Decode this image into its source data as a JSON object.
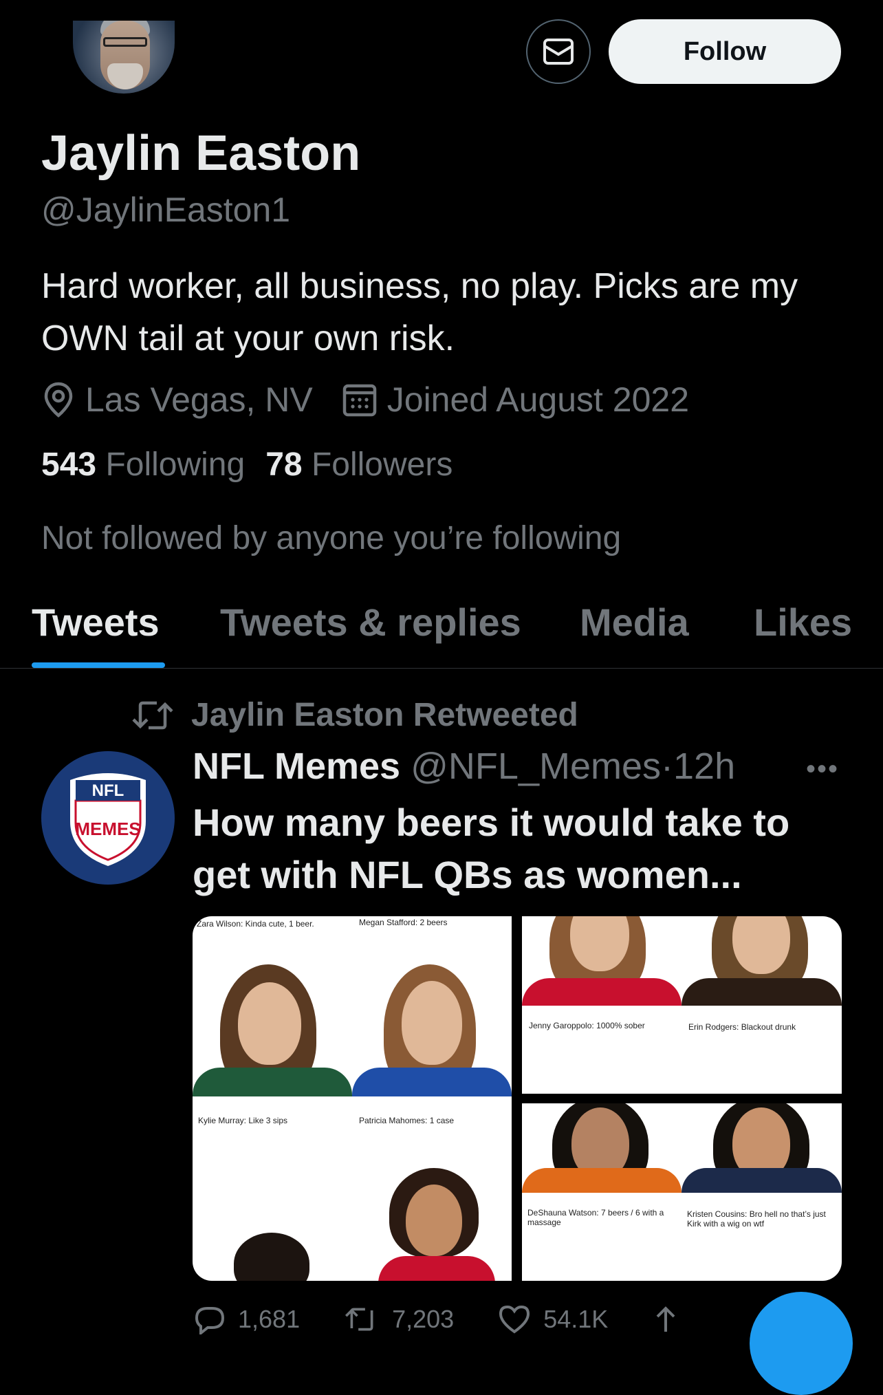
{
  "header": {
    "follow_label": "Follow",
    "message_icon": "envelope-icon"
  },
  "profile": {
    "name": "Jaylin Easton",
    "handle": "@JaylinEaston1",
    "bio": "Hard worker, all business, no play. Picks are my OWN tail at your own risk.",
    "location": "Las Vegas, NV",
    "joined": "Joined August 2022",
    "following_count": "543",
    "following_label": "Following",
    "followers_count": "78",
    "followers_label": "Followers",
    "not_followed": "Not followed by anyone you’re following"
  },
  "tabs": [
    {
      "label": "Tweets",
      "active": true
    },
    {
      "label": "Tweets & replies",
      "active": false
    },
    {
      "label": "Media",
      "active": false
    },
    {
      "label": "Likes",
      "active": false
    }
  ],
  "tweet": {
    "retweeted_by": "Jaylin Easton Retweeted",
    "display_name": "NFL Memes",
    "username": "@NFL_Memes",
    "separator": "·",
    "time": "12h",
    "text": "How many beers it would take to get with NFL QBs as women...",
    "avatar_top": "NFL",
    "avatar_main": "MEMES",
    "media_captions": {
      "tl_1": "Zara Wilson: Kinda cute, 1 beer.",
      "tl_2": "Megan Stafford: 2 beers",
      "tl_3": "Kylie Murray: Like 3 sips",
      "tl_4": "Patricia Mahomes: 1 case",
      "tr_1": "Jenny Garoppolo: 1000% sober",
      "tr_2": "Erin Rodgers: Blackout drunk",
      "br_1": "DeShauna Watson: 7 beers / 6 with a massage",
      "br_2": "Kristen Cousins: Bro hell no that’s just Kirk with a wig on wtf"
    },
    "actions": {
      "replies": "1,681",
      "retweets": "7,203",
      "likes": "54.1K"
    }
  },
  "colors": {
    "accent": "#1d9bf0",
    "secondary_text": "#71767b",
    "primary_text": "#e7e9ea",
    "background": "#000000"
  }
}
